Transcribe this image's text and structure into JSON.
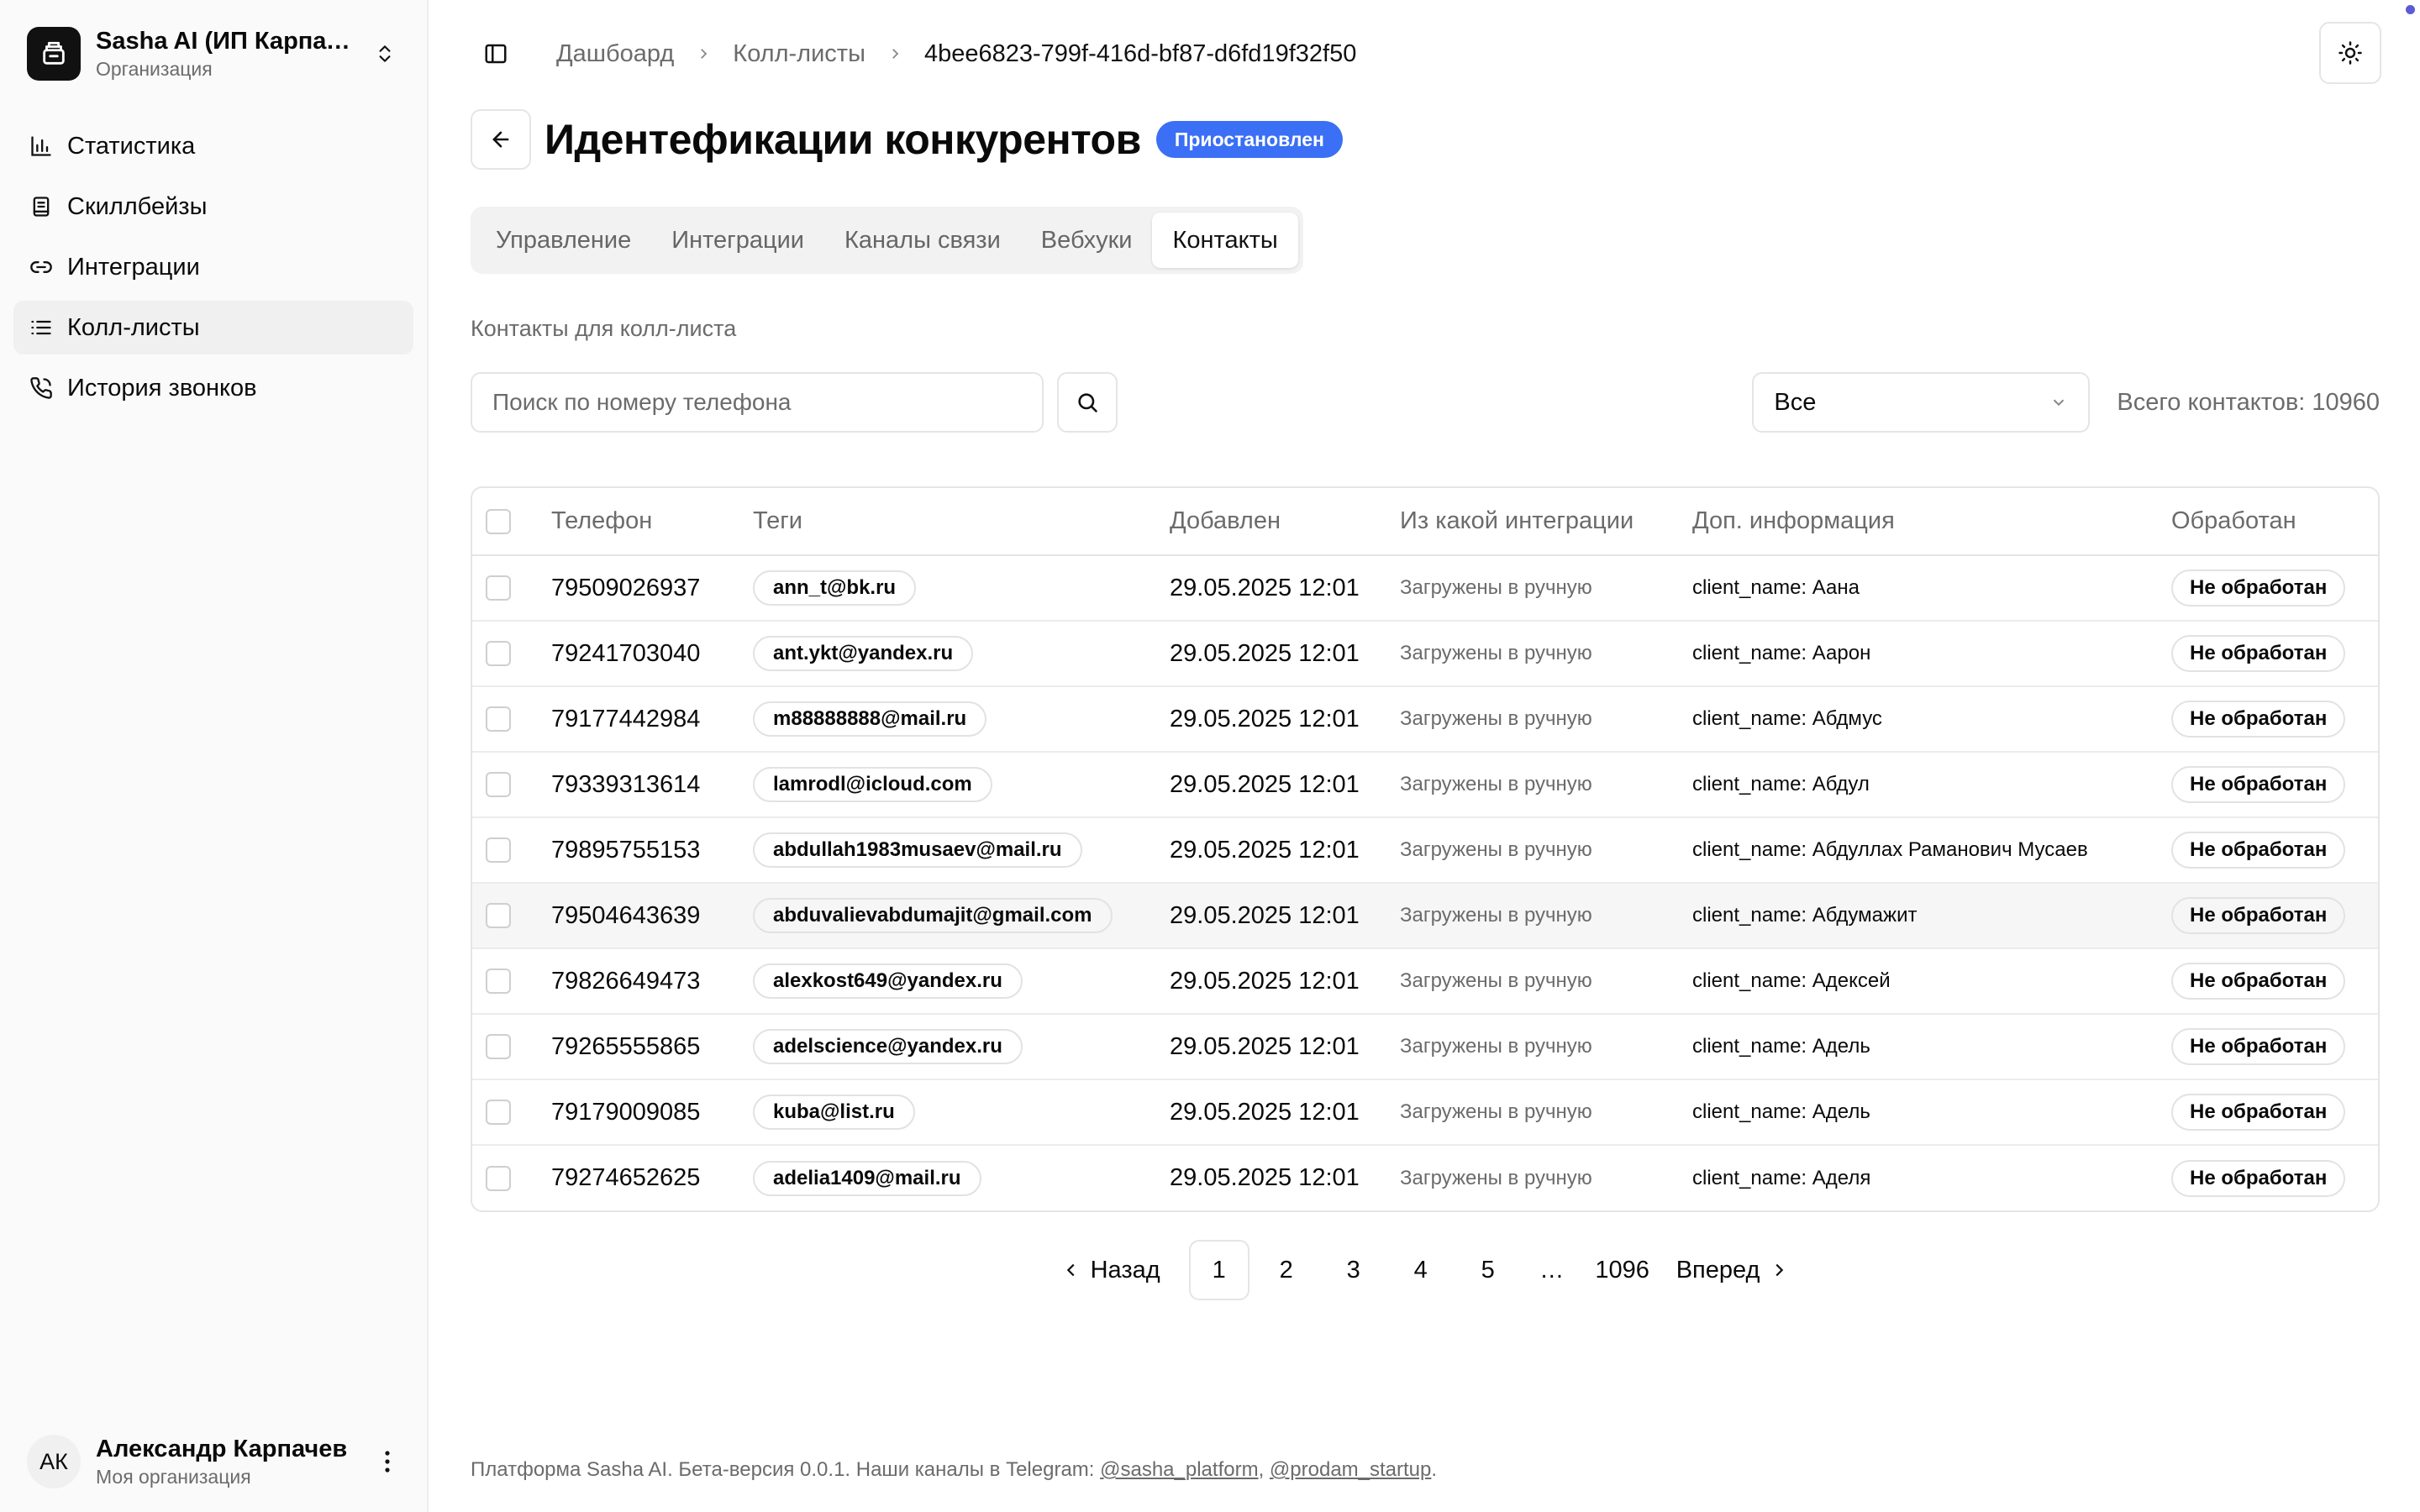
{
  "org": {
    "name": "Sasha AI (ИП Карпаче...",
    "subtitle": "Организация"
  },
  "nav": [
    {
      "label": "Статистика",
      "icon": "bar-chart-icon"
    },
    {
      "label": "Скиллбейзы",
      "icon": "book-icon"
    },
    {
      "label": "Интеграции",
      "icon": "link-icon"
    },
    {
      "label": "Колл-листы",
      "icon": "list-icon",
      "active": true
    },
    {
      "label": "История звонков",
      "icon": "phone-icon"
    }
  ],
  "user": {
    "initials": "АК",
    "name": "Александр Карпачев",
    "subtitle": "Моя организация"
  },
  "breadcrumb": {
    "home": "Дашбоард",
    "section": "Колл-листы",
    "current": "4bee6823-799f-416d-bf87-d6fd19f32f50"
  },
  "page": {
    "title": "Идентефикации конкурентов",
    "status": "Приостановлен"
  },
  "tabs": [
    "Управление",
    "Интеграции",
    "Каналы связи",
    "Вебхуки",
    "Контакты"
  ],
  "active_tab": "Контакты",
  "contacts": {
    "caption": "Контакты для колл-листа",
    "search_placeholder": "Поиск по номеру телефона",
    "filter_value": "Все",
    "total_label": "Всего контактов: 10960"
  },
  "table": {
    "columns": [
      "Телефон",
      "Теги",
      "Добавлен",
      "Из какой интеграции",
      "Доп. информация",
      "Обработан"
    ],
    "rows": [
      {
        "phone": "79509026937",
        "tag": "ann_t@bk.ru",
        "added": "29.05.2025 12:01",
        "source": "Загружены в ручную",
        "info_key": "client_name:",
        "info_val": "Аана",
        "status": "Не обработан"
      },
      {
        "phone": "79241703040",
        "tag": "ant.ykt@yandex.ru",
        "added": "29.05.2025 12:01",
        "source": "Загружены в ручную",
        "info_key": "client_name:",
        "info_val": "Аарон",
        "status": "Не обработан"
      },
      {
        "phone": "79177442984",
        "tag": "m88888888@mail.ru",
        "added": "29.05.2025 12:01",
        "source": "Загружены в ручную",
        "info_key": "client_name:",
        "info_val": "Абдмус",
        "status": "Не обработан"
      },
      {
        "phone": "79339313614",
        "tag": "lamrodl@icloud.com",
        "added": "29.05.2025 12:01",
        "source": "Загружены в ручную",
        "info_key": "client_name:",
        "info_val": "Абдул",
        "status": "Не обработан"
      },
      {
        "phone": "79895755153",
        "tag": "abdullah1983musaev@mail.ru",
        "added": "29.05.2025 12:01",
        "source": "Загружены в ручную",
        "info_key": "client_name:",
        "info_val": "Абдуллах Раманович Мусаев",
        "status": "Не обработан"
      },
      {
        "phone": "79504643639",
        "tag": "abduvalievabdumajit@gmail.com",
        "added": "29.05.2025 12:01",
        "source": "Загружены в ручную",
        "info_key": "client_name:",
        "info_val": "Абдумажит",
        "status": "Не обработан"
      },
      {
        "phone": "79826649473",
        "tag": "alexkost649@yandex.ru",
        "added": "29.05.2025 12:01",
        "source": "Загружены в ручную",
        "info_key": "client_name:",
        "info_val": "Адексей",
        "status": "Не обработан"
      },
      {
        "phone": "79265555865",
        "tag": "adelscience@yandex.ru",
        "added": "29.05.2025 12:01",
        "source": "Загружены в ручную",
        "info_key": "client_name:",
        "info_val": "Адель",
        "status": "Не обработан"
      },
      {
        "phone": "79179009085",
        "tag": "kuba@list.ru",
        "added": "29.05.2025 12:01",
        "source": "Загружены в ручную",
        "info_key": "client_name:",
        "info_val": "Адель",
        "status": "Не обработан"
      },
      {
        "phone": "79274652625",
        "tag": "adelia1409@mail.ru",
        "added": "29.05.2025 12:01",
        "source": "Загружены в ручную",
        "info_key": "client_name:",
        "info_val": "Аделя",
        "status": "Не обработан"
      }
    ]
  },
  "pagination": {
    "prev": "Назад",
    "pages": [
      "1",
      "2",
      "3",
      "4",
      "5"
    ],
    "ellipsis": "…",
    "last": "1096",
    "next": "Вперед",
    "current": "1"
  },
  "footer": {
    "text": "Платформа Sasha AI. Бета-версия 0.0.1. Наши каналы в Telegram:",
    "link1": "@sasha_platform",
    "sep": ",",
    "link2": "@prodam_startup",
    "end": "."
  },
  "colors": {
    "accent": "#3b6ff5",
    "notification_dot": "#5b5bd6"
  }
}
